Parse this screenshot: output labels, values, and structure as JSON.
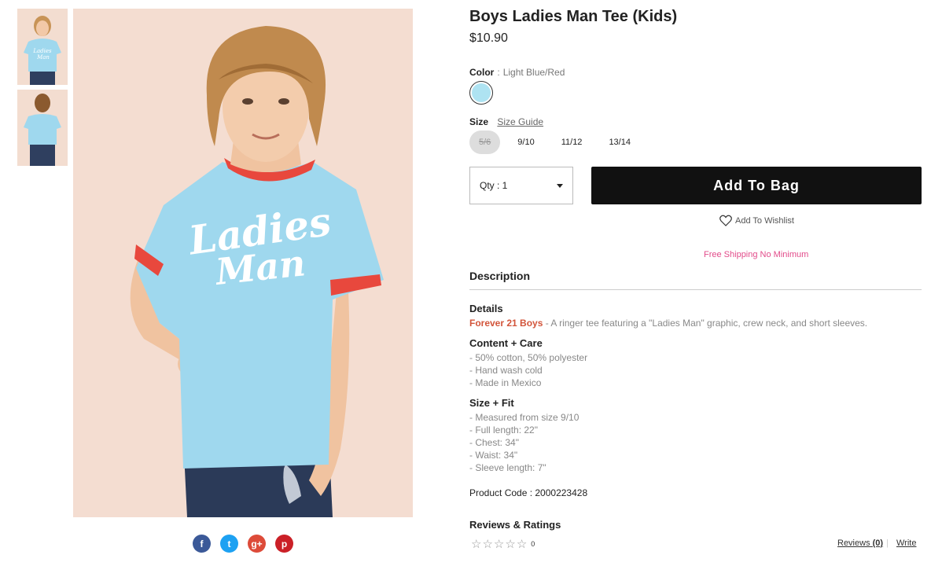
{
  "product": {
    "title": "Boys Ladies Man Tee (Kids)",
    "price": "$10.90",
    "shirt_graphic_line1": "Ladies",
    "shirt_graphic_line2": "Man"
  },
  "color": {
    "label": "Color",
    "separator": ":",
    "value": "Light Blue/Red",
    "swatch_hex": "#aee3f2"
  },
  "size": {
    "label": "Size",
    "guide_label": "Size Guide",
    "options": [
      {
        "label": "5/6",
        "available": false
      },
      {
        "label": "9/10",
        "available": true
      },
      {
        "label": "11/12",
        "available": true
      },
      {
        "label": "13/14",
        "available": true
      }
    ]
  },
  "purchase": {
    "qty_label": "Qty : 1",
    "add_to_bag": "Add To Bag",
    "wishlist": "Add To Wishlist",
    "free_shipping": "Free Shipping No Minimum"
  },
  "description": {
    "heading": "Description",
    "details_heading": "Details",
    "brand": "Forever 21 Boys",
    "details_text": " - A ringer tee featuring a \"Ladies Man\" graphic, crew neck, and short sleeves.",
    "content_heading": "Content + Care",
    "content_lines": [
      "- 50% cotton, 50% polyester",
      "- Hand wash cold",
      "- Made in Mexico"
    ],
    "fit_heading": "Size + Fit",
    "fit_lines": [
      "- Measured from size 9/10",
      "- Full length: 22\"",
      "- Chest: 34\"",
      "- Waist: 34\"",
      "- Sleeve length: 7\""
    ],
    "product_code": "Product Code : 2000223428"
  },
  "reviews": {
    "heading": "Reviews & Ratings",
    "stars": [
      "☆",
      "☆",
      "☆",
      "☆",
      "☆"
    ],
    "count": "0",
    "reviews_label": "Reviews",
    "reviews_count": "(0)",
    "separator": "|",
    "write_label": "Write"
  },
  "social": {
    "facebook": "f",
    "twitter": "t",
    "googleplus": "g+",
    "pinterest": "p"
  },
  "colors": {
    "shirt": "#9fd8ee",
    "trim": "#e8483d",
    "background": "#f4ddd1",
    "brand": "#d2543a",
    "free_shipping": "#e24b8a",
    "cta": "#111111"
  }
}
